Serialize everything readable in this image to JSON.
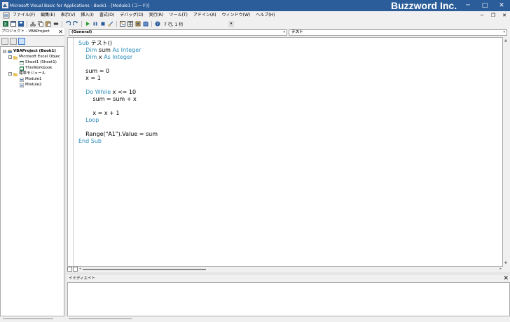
{
  "window": {
    "title": "Microsoft Visual Basic for Applications - Book1 - [Module1 (コード)]",
    "brand": "Buzzword Inc.",
    "buttons": {
      "minimize": "─",
      "maximize": "□",
      "close": "✕"
    }
  },
  "menu": {
    "items": [
      "ファイル(F)",
      "編集(E)",
      "表示(V)",
      "挿入(I)",
      "書式(O)",
      "デバッグ(D)",
      "実行(R)",
      "ツール(T)",
      "アドイン(A)",
      "ウィンドウ(W)",
      "ヘルプ(H)"
    ],
    "mdi_buttons": {
      "minimize": "─",
      "restore": "❐",
      "close": "✕"
    }
  },
  "toolbar": {
    "position": "7 行, 1 桁",
    "icons": [
      "excel-icon",
      "insert-module-icon",
      "save-icon",
      "cut-icon",
      "copy-icon",
      "paste-icon",
      "find-icon",
      "undo-icon",
      "redo-icon",
      "run-icon",
      "break-icon",
      "reset-icon",
      "design-mode-icon",
      "project-explorer-icon",
      "properties-icon",
      "object-browser-icon",
      "toolbox-icon",
      "help-icon"
    ]
  },
  "project_panel": {
    "title": "プロジェクト - VBAProject",
    "close": "✕",
    "tree": [
      {
        "label": "VBAProject (Book1)",
        "level": 0,
        "bold": true,
        "expander": "−"
      },
      {
        "label": "Microsoft Excel Objec",
        "level": 1,
        "bold": false,
        "expander": "−"
      },
      {
        "label": "Sheet1 (Sheet1)",
        "level": 2,
        "bold": false,
        "expander": ""
      },
      {
        "label": "ThisWorkbook",
        "level": 2,
        "bold": false,
        "expander": ""
      },
      {
        "label": "標準モジュール",
        "level": 1,
        "bold": false,
        "expander": "−"
      },
      {
        "label": "Module1",
        "level": 2,
        "bold": false,
        "expander": ""
      },
      {
        "label": "Module2",
        "level": 2,
        "bold": false,
        "expander": ""
      }
    ]
  },
  "code_window": {
    "object_combo": "(General)",
    "proc_combo": "テスト",
    "lines": [
      [
        {
          "t": "Sub",
          "k": true
        },
        {
          "t": " テスト()",
          "k": false
        }
      ],
      [
        {
          "t": "    ",
          "k": false
        },
        {
          "t": "Dim",
          "k": true
        },
        {
          "t": " sum ",
          "k": false
        },
        {
          "t": "As Integer",
          "k": true
        }
      ],
      [
        {
          "t": "    ",
          "k": false
        },
        {
          "t": "Dim",
          "k": true
        },
        {
          "t": " x ",
          "k": false
        },
        {
          "t": "As Integer",
          "k": true
        }
      ],
      [],
      [
        {
          "t": "    sum = 0",
          "k": false
        }
      ],
      [
        {
          "t": "    x = 1",
          "k": false
        }
      ],
      [],
      [
        {
          "t": "    ",
          "k": false
        },
        {
          "t": "Do While",
          "k": true
        },
        {
          "t": " x <= 10",
          "k": false
        }
      ],
      [
        {
          "t": "        sum = sum + x",
          "k": false
        }
      ],
      [],
      [
        {
          "t": "        x = x + 1",
          "k": false
        }
      ],
      [
        {
          "t": "    ",
          "k": false
        },
        {
          "t": "Loop",
          "k": true
        }
      ],
      [],
      [
        {
          "t": "    Range(\"A1\").Value = sum",
          "k": false
        }
      ],
      [
        {
          "t": "End Sub",
          "k": true
        }
      ]
    ]
  },
  "immediate": {
    "title": "イミディエイト",
    "close": "✕"
  },
  "colors": {
    "titlebar": "#2b5d9a",
    "keyword": "#2a8dbb"
  }
}
